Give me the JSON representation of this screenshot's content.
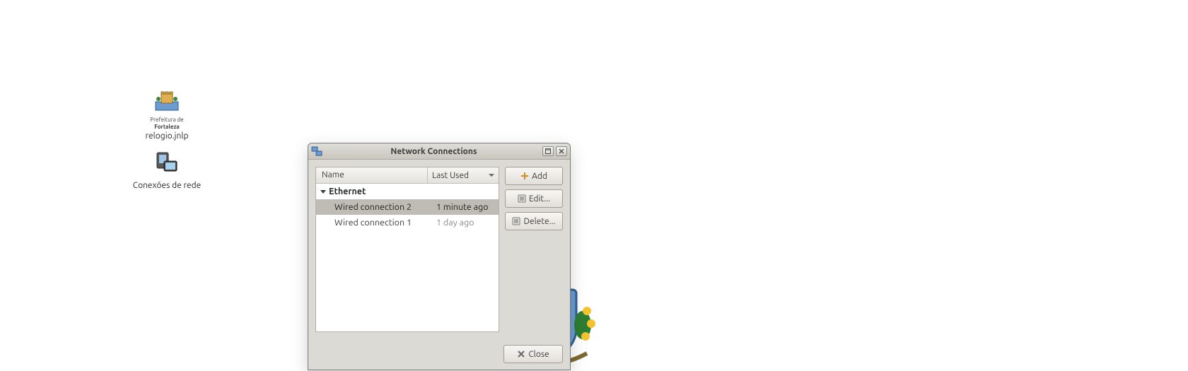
{
  "desktop": {
    "icons": [
      {
        "label_line1": "Prefeitura de",
        "label_line2": "Fortaleza",
        "filename": "relogio.jnlp"
      },
      {
        "label": "Conexões de rede"
      }
    ]
  },
  "window": {
    "title": "Network Connections",
    "columns": {
      "name": "Name",
      "last_used": "Last Used"
    },
    "group": "Ethernet",
    "connections": [
      {
        "name": "Wired connection 2",
        "last_used": "1 minute ago",
        "selected": true
      },
      {
        "name": "Wired connection 1",
        "last_used": "1 day ago",
        "selected": false
      }
    ],
    "buttons": {
      "add": "Add",
      "edit": "Edit...",
      "delete": "Delete...",
      "close": "Close"
    }
  }
}
